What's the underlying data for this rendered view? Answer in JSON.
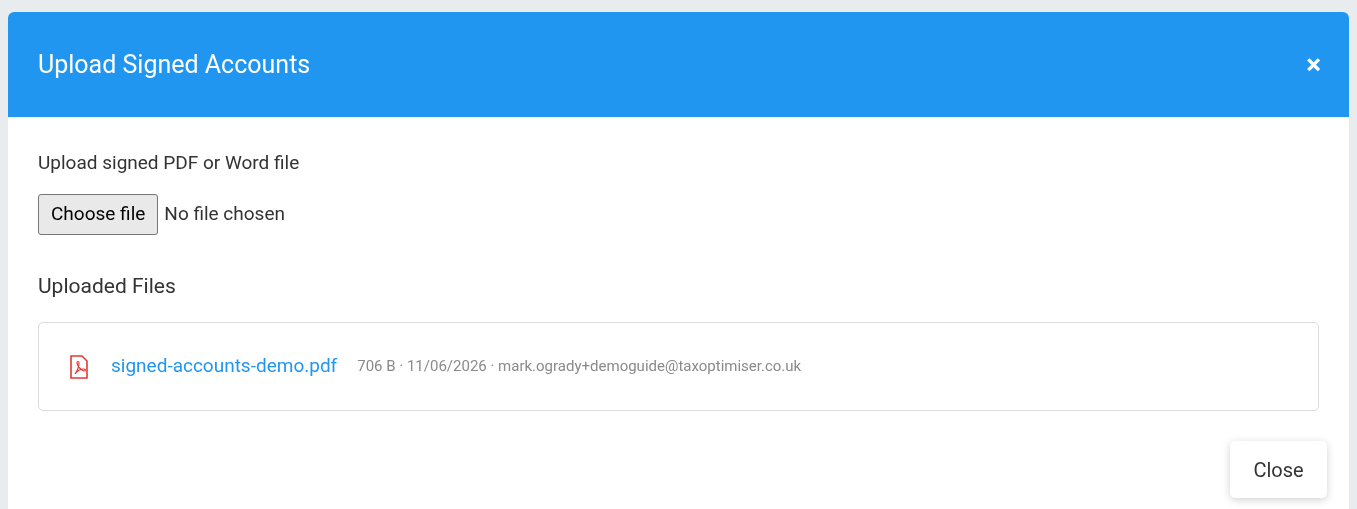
{
  "dialog": {
    "title": "Upload Signed Accounts",
    "close_icon": "×"
  },
  "upload": {
    "label": "Upload signed PDF or Word file",
    "button": "Choose file",
    "status": "No file chosen"
  },
  "uploaded_files": {
    "heading": "Uploaded Files",
    "files": [
      {
        "kind": "pdf",
        "name": "signed-accounts-demo.pdf",
        "meta": "706 B · 11/06/2026 · mark.ogrady+demoguide@taxoptimiser.co.uk"
      }
    ]
  },
  "footer": {
    "button": "Close"
  }
}
